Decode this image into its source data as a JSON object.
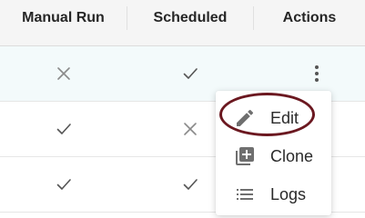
{
  "table": {
    "headers": [
      "Manual Run",
      "Scheduled",
      "Actions"
    ],
    "rows": [
      {
        "manual_run": "cross",
        "scheduled": "check"
      },
      {
        "manual_run": "check",
        "scheduled": "cross"
      },
      {
        "manual_run": "check",
        "scheduled": "check"
      }
    ]
  },
  "menu": {
    "items": [
      {
        "label": "Edit",
        "icon": "pencil-icon"
      },
      {
        "label": "Clone",
        "icon": "clone-icon"
      },
      {
        "label": "Logs",
        "icon": "list-icon"
      }
    ]
  },
  "colors": {
    "highlight_ring": "#6b1820",
    "selected_row_bg": "#f3fafb",
    "header_bg": "#f5f5f5",
    "icon_gray": "#757575"
  }
}
